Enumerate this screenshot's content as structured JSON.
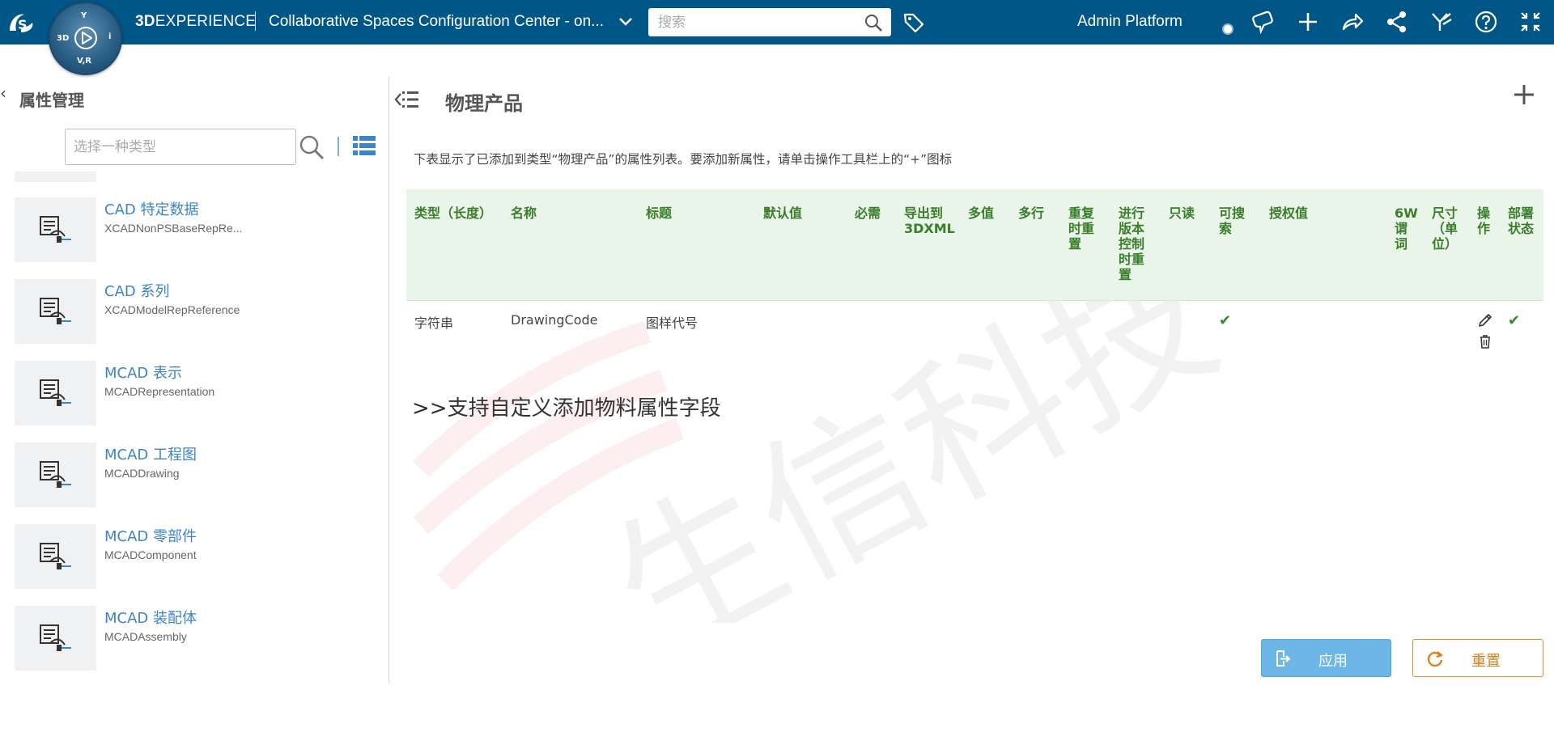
{
  "topbar": {
    "brand_bold": "3D",
    "brand_rest": "EXPERIENCE",
    "app_title": "Collaborative Spaces Configuration Center - on...",
    "search_placeholder": "搜索",
    "platform": "Admin Platform",
    "compass": {
      "top": "Y",
      "left": "3D",
      "right": "i",
      "bottom": "V,R"
    },
    "icons": [
      "tag-icon",
      "status-dot",
      "chat-icon",
      "plus-icon",
      "share-arrow-icon",
      "network-share-icon",
      "tools-icon",
      "help-icon",
      "fullscreen-icon"
    ],
    "colors": {
      "bar": "#005686"
    }
  },
  "left": {
    "title": "属性管理",
    "type_placeholder": "选择一种类型",
    "items": [
      {
        "name": "CAD 特定数据",
        "sub": "XCADNonPSBaseRepRe..."
      },
      {
        "name": "CAD 系列",
        "sub": "XCADModelRepReference"
      },
      {
        "name": "MCAD 表示",
        "sub": "MCADRepresentation"
      },
      {
        "name": "MCAD 工程图",
        "sub": "MCADDrawing"
      },
      {
        "name": "MCAD 零部件",
        "sub": "MCADComponent"
      },
      {
        "name": "MCAD 装配体",
        "sub": "MCADAssembly"
      }
    ]
  },
  "main": {
    "title": "物理产品",
    "description": "下表显示了已添加到类型“物理产品”的属性列表。要添加新属性，请单击操作工具栏上的“+”图标",
    "columns": [
      "类型（长度）",
      "名称",
      "标题",
      "默认值",
      "必需",
      "导出到3DXML",
      "多值",
      "多行",
      "重复时重置",
      "进行版本控制时重置",
      "只读",
      "可搜索",
      "授权值",
      "6W谓词",
      "尺寸（单位）",
      "操作",
      "部署状态"
    ],
    "rows": [
      {
        "type": "字符串",
        "name": "DrawingCode",
        "title": "图样代号",
        "searchable": true,
        "deployed": true
      }
    ],
    "promo": ">>支持自定义添加物料属性字段",
    "watermark": "生信科技",
    "apply_label": "应用",
    "reset_label": "重置",
    "colors": {
      "header_bg": "#e9f5e8",
      "header_text": "#3a7d2a",
      "check": "#2e8b2e",
      "apply": "#6cb7e8",
      "reset": "#e07e1c"
    }
  }
}
